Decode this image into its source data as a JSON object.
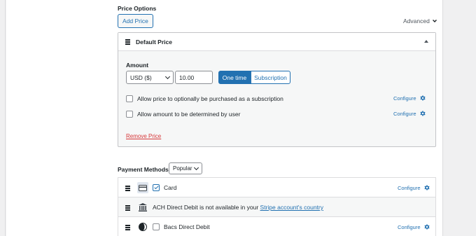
{
  "price_options": {
    "title": "Price Options",
    "add_price_label": "Add Price",
    "advanced_label": "Advanced"
  },
  "price_card": {
    "title": "Default Price",
    "amount_label": "Amount",
    "currency_value": "USD ($)",
    "amount_value": "10.00",
    "one_time_label": "One time",
    "subscription_label": "Subscription",
    "selected_type": "One time",
    "options": [
      {
        "label": "Allow price to optionally be purchased as a subscription",
        "checked": false,
        "configure_label": "Configure"
      },
      {
        "label": "Allow amount to be determined by user",
        "checked": false,
        "configure_label": "Configure"
      }
    ],
    "remove_label": "Remove Price"
  },
  "payment_methods": {
    "title": "Payment Methods",
    "filter_value": "Popular",
    "items": [
      {
        "label": "Card",
        "checked": true,
        "configure_label": "Configure",
        "icon": "credit-card-icon"
      },
      {
        "text_prefix": "ACH Direct Debit is not available in your ",
        "link_text": "Stripe account's country",
        "icon": "bank-icon"
      },
      {
        "label": "Bacs Direct Debit",
        "checked": false,
        "configure_label": "Configure",
        "icon": "bacs-icon"
      }
    ]
  },
  "colors": {
    "accent": "#2271b1",
    "danger": "#d63638",
    "border": "#c3c4c7",
    "panel_bg": "#f6f7f7"
  }
}
